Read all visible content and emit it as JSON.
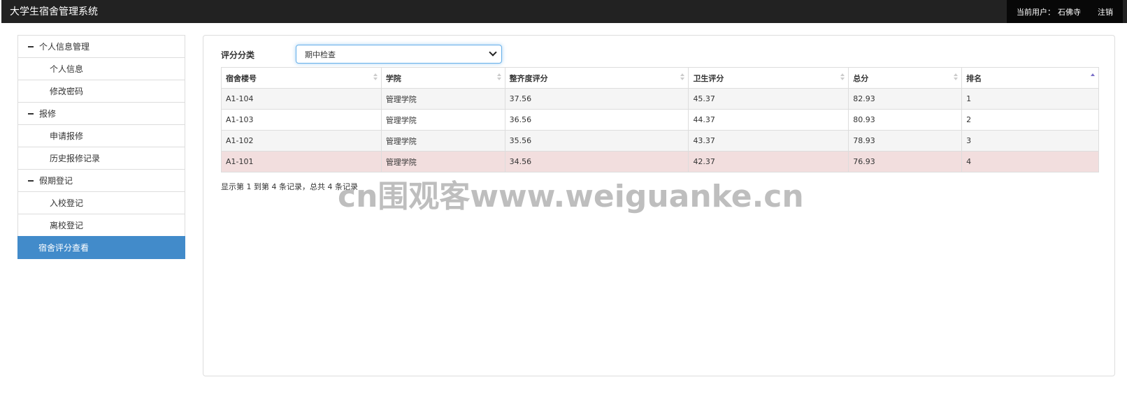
{
  "header": {
    "title": "大学生宿舍管理系统",
    "current_user_label": "当前用户：",
    "current_user": "石佛寺",
    "logout": "注销"
  },
  "sidebar": {
    "groups": [
      {
        "label": "个人信息管理",
        "items": [
          {
            "label": "个人信息"
          },
          {
            "label": "修改密码"
          }
        ]
      },
      {
        "label": "报修",
        "items": [
          {
            "label": "申请报修"
          },
          {
            "label": "历史报修记录"
          }
        ]
      },
      {
        "label": "假期登记",
        "items": [
          {
            "label": "入校登记"
          },
          {
            "label": "离校登记"
          }
        ]
      }
    ],
    "active_item": {
      "label": "宿舍评分查看"
    }
  },
  "main": {
    "filter_label": "评分分类",
    "filter_selected": "期中检查",
    "columns": [
      "宿舍楼号",
      "学院",
      "整齐度评分",
      "卫生评分",
      "总分",
      "排名"
    ],
    "sorted_column": "排名",
    "rows": [
      [
        "A1-104",
        "管理学院",
        "37.56",
        "45.37",
        "82.93",
        "1"
      ],
      [
        "A1-103",
        "管理学院",
        "36.56",
        "44.37",
        "80.93",
        "2"
      ],
      [
        "A1-102",
        "管理学院",
        "35.56",
        "43.37",
        "78.93",
        "3"
      ],
      [
        "A1-101",
        "管理学院",
        "34.56",
        "42.37",
        "76.93",
        "4"
      ]
    ],
    "highlighted_row": 3,
    "pagination_info": "显示第 1 到第 4 条记录，总共 4 条记录"
  },
  "watermark": "cn围观客www.weiguanke.cn",
  "colors": {
    "topbar": "#222222",
    "active_item": "#428bca",
    "row_highlight": "#f2dede",
    "sort_active": "#7a6fc8"
  }
}
